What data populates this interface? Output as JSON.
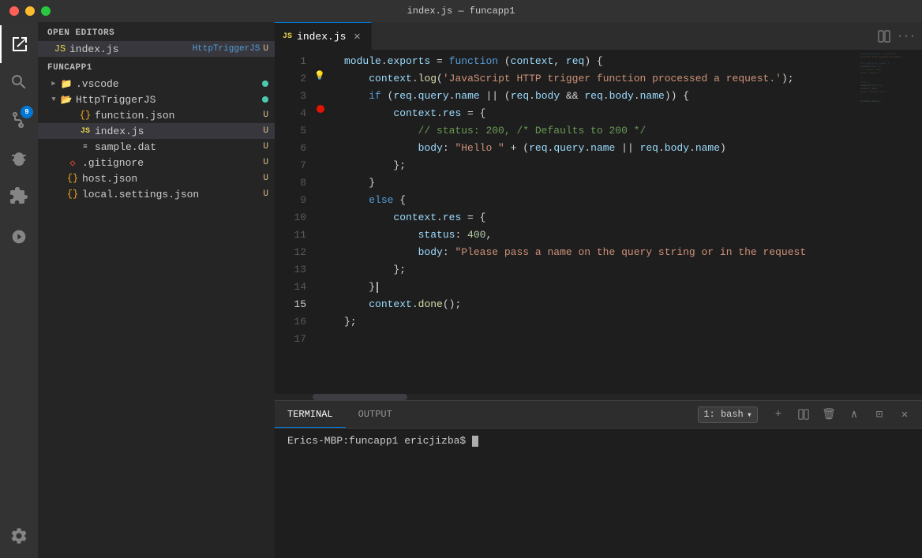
{
  "titlebar": {
    "title": "index.js — funcapp1"
  },
  "activity_bar": {
    "icons": [
      {
        "name": "explorer-icon",
        "label": "Explorer",
        "active": true,
        "badge": null
      },
      {
        "name": "search-icon",
        "label": "Search",
        "active": false,
        "badge": null
      },
      {
        "name": "source-control-icon",
        "label": "Source Control",
        "active": false,
        "badge": "9"
      },
      {
        "name": "debug-icon",
        "label": "Run and Debug",
        "active": false,
        "badge": null
      },
      {
        "name": "extensions-icon",
        "label": "Extensions",
        "active": false,
        "badge": null
      },
      {
        "name": "remote-icon",
        "label": "Remote",
        "active": false,
        "badge": null
      }
    ],
    "bottom_icons": [
      {
        "name": "settings-icon",
        "label": "Settings"
      }
    ]
  },
  "sidebar": {
    "open_editors_label": "OPEN EDITORS",
    "open_editors": [
      {
        "icon": "js",
        "name": "index.js",
        "context": "HttpTriggerJS",
        "modifier": "U",
        "active": true
      }
    ],
    "funcapp1_label": "FUNCAPP1",
    "tree": [
      {
        "level": 0,
        "arrow": "▶",
        "icon": "folder",
        "name": ".vscode",
        "dot_color": "green",
        "modifier": ""
      },
      {
        "level": 0,
        "arrow": "▼",
        "icon": "folder",
        "name": "HttpTriggerJS",
        "dot_color": "green",
        "modifier": ""
      },
      {
        "level": 1,
        "arrow": "",
        "icon": "json",
        "name": "function.json",
        "dot_color": null,
        "modifier": "U"
      },
      {
        "level": 1,
        "arrow": "",
        "icon": "js",
        "name": "index.js",
        "dot_color": null,
        "modifier": "U",
        "active": true
      },
      {
        "level": 1,
        "arrow": "",
        "icon": "dat",
        "name": "sample.dat",
        "dot_color": null,
        "modifier": "U"
      },
      {
        "level": 0,
        "arrow": "",
        "icon": "git",
        "name": ".gitignore",
        "dot_color": null,
        "modifier": "U"
      },
      {
        "level": 0,
        "arrow": "",
        "icon": "json",
        "name": "host.json",
        "dot_color": null,
        "modifier": "U"
      },
      {
        "level": 0,
        "arrow": "",
        "icon": "json",
        "name": "local.settings.json",
        "dot_color": null,
        "modifier": "U"
      }
    ]
  },
  "editor": {
    "tab_label": "index.js",
    "tab_icon": "js",
    "lines": [
      {
        "num": 1,
        "content": "module.exports = function (context, req) {"
      },
      {
        "num": 2,
        "content": "    context.log('JavaScript HTTP trigger function processed a request.');"
      },
      {
        "num": 3,
        "content": ""
      },
      {
        "num": 4,
        "content": "    if (req.query.name || (req.body && req.body.name)) {",
        "breakpoint": true
      },
      {
        "num": 5,
        "content": "        context.res = {"
      },
      {
        "num": 6,
        "content": "            // status: 200, /* Defaults to 200 */"
      },
      {
        "num": 7,
        "content": "            body: \"Hello \" + (req.query.name || req.body.name)"
      },
      {
        "num": 8,
        "content": "        };"
      },
      {
        "num": 9,
        "content": "    }"
      },
      {
        "num": 10,
        "content": "    else {"
      },
      {
        "num": 11,
        "content": "        context.res = {"
      },
      {
        "num": 12,
        "content": "            status: 400,"
      },
      {
        "num": 13,
        "content": "            body: \"Please pass a name on the query string or in the request"
      },
      {
        "num": 14,
        "content": "        };"
      },
      {
        "num": 15,
        "content": "    }"
      },
      {
        "num": 16,
        "content": "    context.done();"
      },
      {
        "num": 17,
        "content": "};"
      }
    ]
  },
  "terminal": {
    "terminal_label": "TERMINAL",
    "output_label": "OUTPUT",
    "shell_selector": "1: bash",
    "prompt": "Erics-MBP:funcapp1 ericjizba$ ",
    "cursor": "█"
  },
  "panel_controls": {
    "add": "+",
    "split": "⊞",
    "trash": "🗑",
    "chevron_up": "∧",
    "panel": "⊡",
    "close": "✕"
  }
}
